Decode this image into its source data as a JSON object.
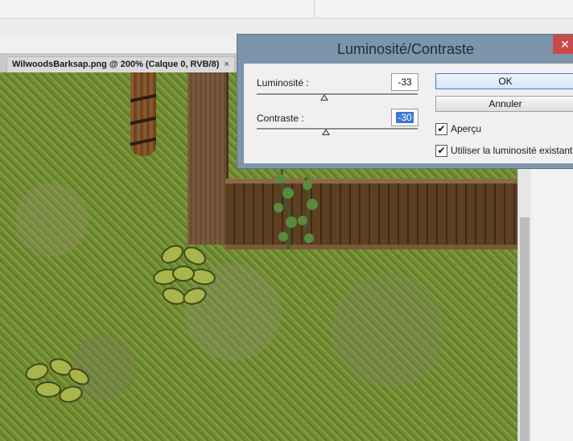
{
  "document": {
    "tab_title": "WilwoodsBarksap.png @ 200% (Calque 0, RVB/8)",
    "tab_close": "×"
  },
  "dialog": {
    "title": "Luminosité/Contraste",
    "close_glyph": "✕",
    "luminosite": {
      "label": "Luminosité :",
      "value": "-33",
      "slider_fraction": 0.42
    },
    "contraste": {
      "label": "Contraste :",
      "value": "-30",
      "slider_fraction": 0.43
    },
    "ok_label": "OK",
    "cancel_label": "Annuler",
    "preview": {
      "label": "Aperçu",
      "checked": true
    },
    "legacy": {
      "label": "Utiliser la luminosité existante",
      "checked": true
    },
    "check_glyph": "✔"
  },
  "colors": {
    "dialog_frame": "#7c95aa",
    "close_red": "#c94a4a",
    "selection_blue": "#3b79d3"
  }
}
